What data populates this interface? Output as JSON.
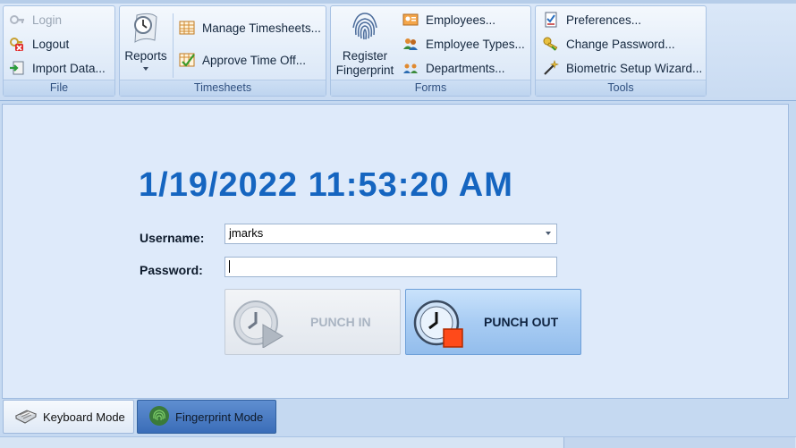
{
  "ribbon": {
    "file": {
      "label": "File",
      "login": "Login",
      "logout": "Logout",
      "import": "Import Data..."
    },
    "timesheets": {
      "label": "Timesheets",
      "reports": "Reports",
      "manage": "Manage Timesheets...",
      "approve": "Approve Time Off..."
    },
    "forms": {
      "label": "Forms",
      "register_line1": "Register",
      "register_line2": "Fingerprint",
      "employees": "Employees...",
      "employee_types": "Employee Types...",
      "departments": "Departments..."
    },
    "tools": {
      "label": "Tools",
      "preferences": "Preferences...",
      "change_password": "Change Password...",
      "biometric": "Biometric Setup Wizard..."
    }
  },
  "main": {
    "datetime": "1/19/2022 11:53:20 AM",
    "username_label": "Username:",
    "username_value": "jmarks",
    "password_label": "Password:",
    "password_value": "",
    "punch_in": "PUNCH IN",
    "punch_out": "PUNCH OUT"
  },
  "tabs": {
    "keyboard": "Keyboard Mode",
    "fingerprint": "Fingerprint Mode"
  },
  "colors": {
    "clock": "#1565c0",
    "ribbon_bg": "#dbe8f8",
    "panel_bg": "#deeafa",
    "punch_out_bg": "#a8ccf3",
    "fingerprint_tab": "#4a7cc4"
  }
}
